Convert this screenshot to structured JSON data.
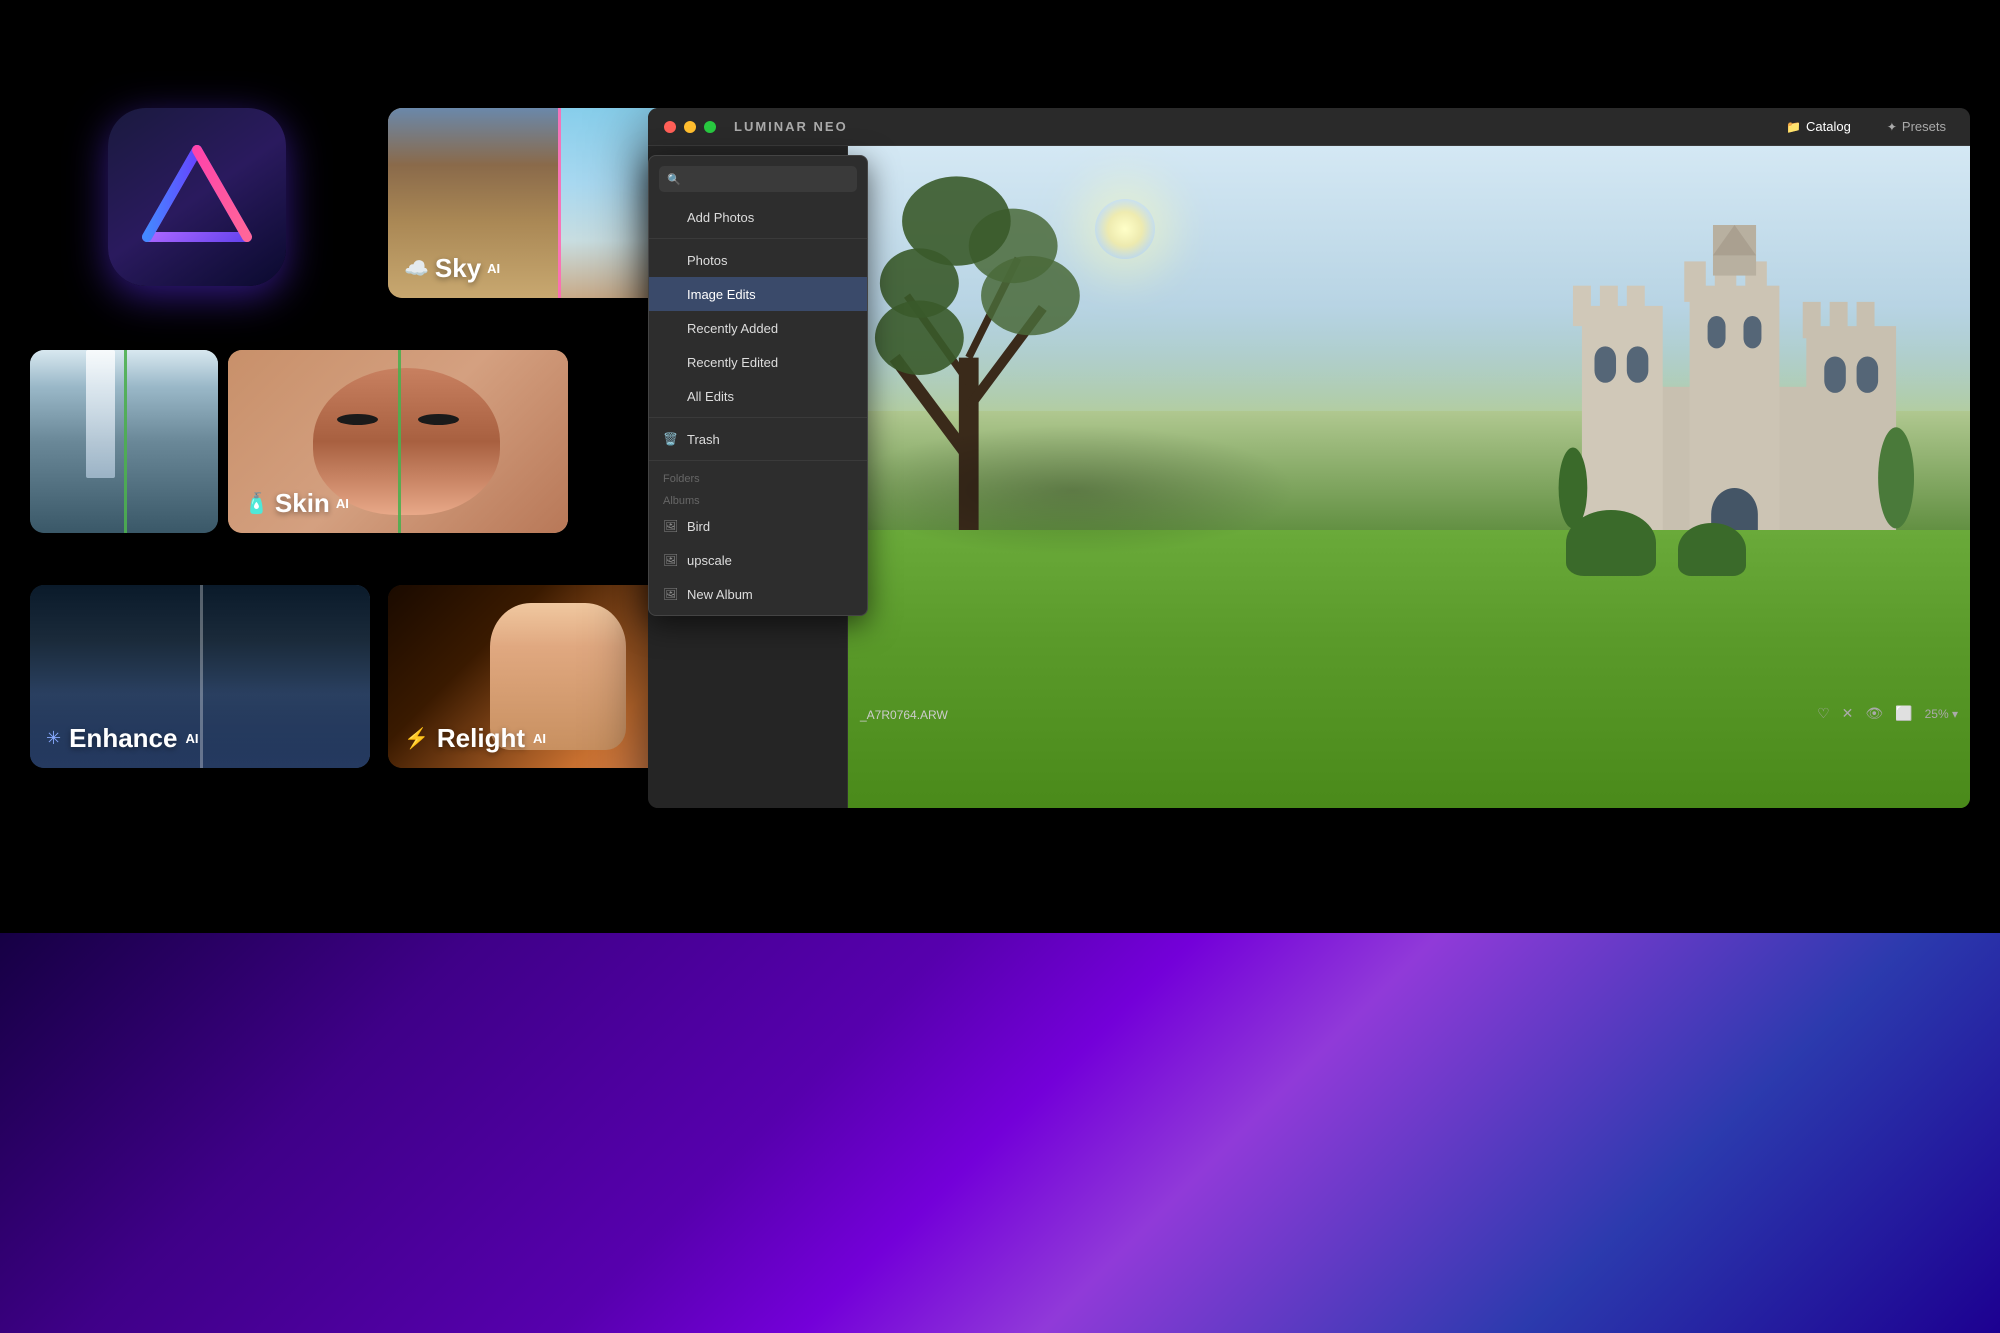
{
  "app": {
    "name": "LUMINAR NEO",
    "window_title": "LUMINAR NEO"
  },
  "title_bar": {
    "catalog_label": "Catalog",
    "presets_label": "Presets",
    "catalog_icon": "📁",
    "presets_icon": "✦"
  },
  "sidebar": {
    "search_placeholder": "Search",
    "add_photos_label": "Add Photos",
    "items": [
      {
        "label": "Photos",
        "icon": "🖼",
        "id": "photos"
      },
      {
        "label": "Image Edits",
        "icon": "✏️",
        "id": "image-edits",
        "active": true
      },
      {
        "label": "Recently Added",
        "icon": "⊕",
        "id": "recently-added"
      },
      {
        "label": "Recently Edited",
        "icon": "⊙",
        "id": "recently-edited"
      },
      {
        "label": "All Edits",
        "icon": "◷",
        "id": "all-edits"
      }
    ],
    "trash_label": "Trash",
    "folders_section": "Folders",
    "albums_section": "Albums",
    "albums": [
      {
        "label": "Bird",
        "icon": "🖼"
      },
      {
        "label": "upscale",
        "icon": "🖼"
      },
      {
        "label": "New Album",
        "icon": "🖼"
      }
    ]
  },
  "main_view": {
    "filename": "_A7R0764.ARW",
    "zoom": "25%"
  },
  "feature_cards": {
    "sky": {
      "label": "Sky",
      "ai_suffix": "AI",
      "icon": "☁️"
    },
    "skin": {
      "label": "Skin",
      "ai_suffix": "AI",
      "icon": "🧴"
    },
    "enhance": {
      "label": "Enhance",
      "ai_suffix": "AI",
      "icon": "✳"
    },
    "relight": {
      "label": "Relight",
      "ai_suffix": "AI",
      "icon": "⚡"
    }
  },
  "bottom_bar": {
    "controls": [
      "♡",
      "✕",
      "👁",
      "⬜"
    ],
    "zoom_label": "25%"
  }
}
